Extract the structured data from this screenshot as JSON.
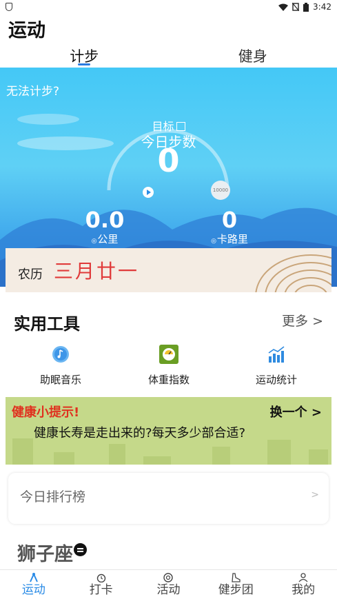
{
  "status_bar": {
    "time": "3:42"
  },
  "page_title": "运动",
  "top_tabs": [
    {
      "label": "计步",
      "active": true
    },
    {
      "label": "健身",
      "active": false
    }
  ],
  "hero": {
    "cannot_count": "无法计步?",
    "goal_label": "目标",
    "steps_label": "今日步数",
    "steps_value": "0",
    "goal_value": "10000",
    "distance_value": "0.0",
    "distance_unit": "公里",
    "calories_value": "0",
    "calories_unit": "卡路里",
    "lunar_label": "农历",
    "lunar_date": "三月廿一"
  },
  "tools": {
    "title": "实用工具",
    "more": "更多 >",
    "items": [
      {
        "label": "助眠音乐",
        "icon": "music-icon"
      },
      {
        "label": "体重指数",
        "icon": "scale-icon"
      },
      {
        "label": "运动统计",
        "icon": "stats-icon"
      }
    ]
  },
  "health_tip": {
    "title": "健康小提示!",
    "switch": "换一个 >",
    "text": "健康长寿是走出来的?每天多少部合适?"
  },
  "ranking": {
    "label": "今日排行榜",
    "chevron": ">"
  },
  "zodiac": {
    "label": "狮子座"
  },
  "bottom_nav": [
    {
      "label": "运动",
      "icon": "sport-icon",
      "active": true
    },
    {
      "label": "打卡",
      "icon": "alarm-icon",
      "active": false
    },
    {
      "label": "活动",
      "icon": "activity-icon",
      "active": false
    },
    {
      "label": "健步团",
      "icon": "shoe-icon",
      "active": false
    },
    {
      "label": "我的",
      "icon": "user-icon",
      "active": false
    }
  ],
  "colors": {
    "accent": "#2a8be6",
    "hero_top": "#44c8f6",
    "hero_bottom": "#2b8ee6",
    "tip_title": "#e0311f",
    "tip_bg": "#c5d98a",
    "lunar_date": "#e03a3a"
  }
}
